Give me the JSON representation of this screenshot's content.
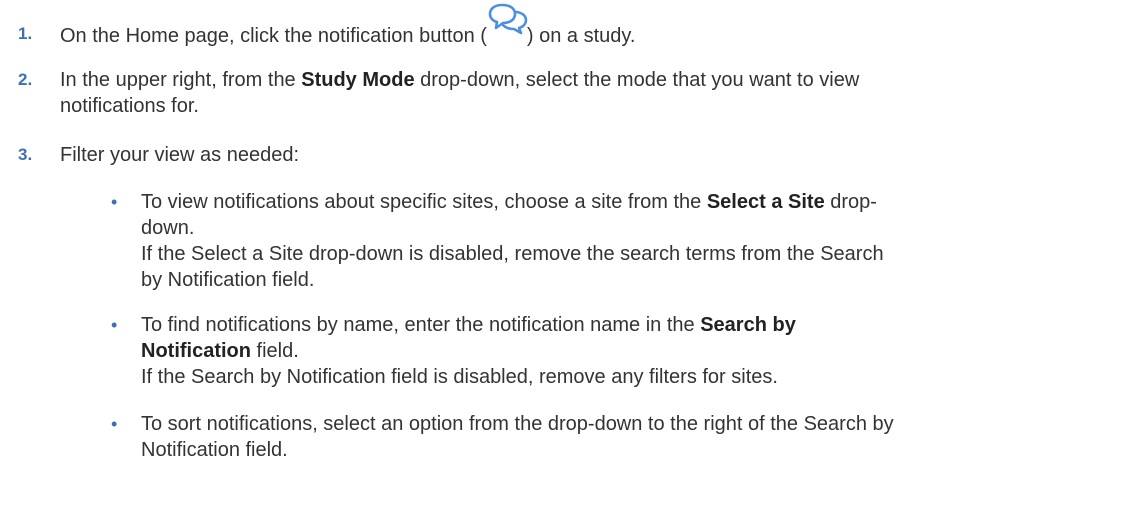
{
  "steps": [
    {
      "num": "1.",
      "pre": "On the Home page, click the notification button (",
      "icon": "chat-bubbles-icon",
      "post": ") on a study."
    },
    {
      "num": "2.",
      "pre": "In the upper right, from the ",
      "bold": "Study Mode",
      "post_line1": " drop-down, select the mode that you want to view",
      "line2": "notifications for."
    },
    {
      "num": "3.",
      "text": "Filter your view as needed:"
    }
  ],
  "bullets": [
    {
      "pre": "To view notifications about specific sites, choose a site from the ",
      "bold": "Select a Site",
      "post": " drop-",
      "line2": "down.",
      "note_line1": "If the Select a Site drop-down is disabled, remove the search terms from the Search",
      "note_line2": "by Notification field."
    },
    {
      "pre": "To find notifications by name, enter the notification name in the ",
      "bold_line1": "Search by",
      "bold_line2": "Notification",
      "post": " field.",
      "note_line1": "If the Search by Notification field is disabled, remove any filters for sites."
    },
    {
      "line1": "To sort notifications, select an option from the drop-down to the right of the Search by",
      "line2": "Notification field."
    }
  ],
  "colors": {
    "accent": "#3d6fb3",
    "icon": "#4a90e2",
    "text": "#333333"
  }
}
